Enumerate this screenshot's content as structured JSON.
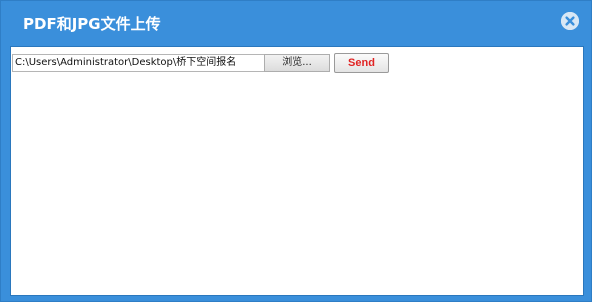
{
  "dialog": {
    "title": "PDF和JPG文件上传",
    "close_icon": "close-circle-icon"
  },
  "upload": {
    "file_path": "C:\\Users\\Administrator\\Desktop\\桥下空间报名",
    "browse_label": "浏览...",
    "send_label": "Send"
  },
  "colors": {
    "titlebar": "#3a8fdb",
    "send_text": "#e02424"
  }
}
